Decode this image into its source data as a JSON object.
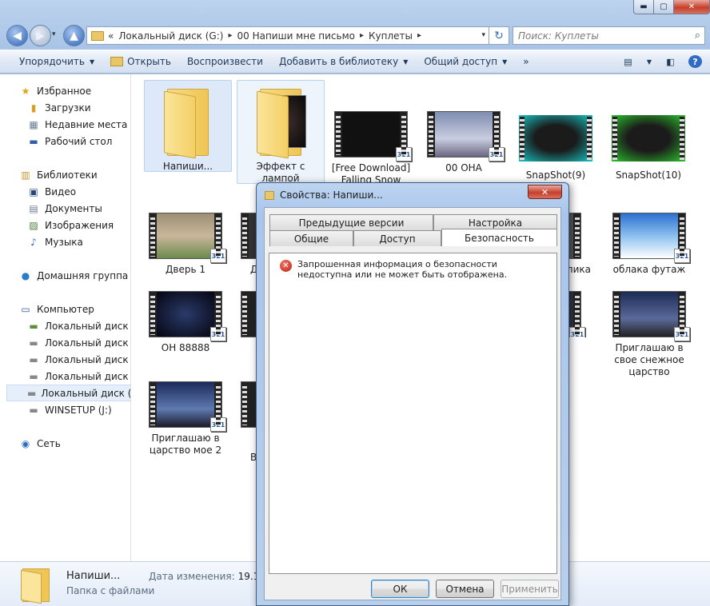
{
  "window": {
    "min": "▬",
    "max": "▢",
    "close": "✕"
  },
  "nav_buttons": {
    "back": "◀",
    "forward": "▶",
    "dropdown": "▾",
    "up": "▲"
  },
  "address": {
    "prefix": "«",
    "crumbs": [
      "Локальный диск (G:)",
      "00 Напиши мне письмо",
      "Куплеты"
    ],
    "sep": "▸",
    "dropdown": "▾",
    "refresh": "↻"
  },
  "search": {
    "placeholder": "Поиск: Куплеты",
    "icon": "⌕"
  },
  "toolbar": {
    "organize": "Упорядочить",
    "open": "Открыть",
    "play": "Воспроизвести",
    "add_library": "Добавить в библиотеку",
    "share": "Общий доступ",
    "more": "»",
    "dd": "▼",
    "view_icon": "▤",
    "preview_icon": "◧",
    "help_icon": "?"
  },
  "nav": {
    "favorites": "Избранное",
    "downloads": "Загрузки",
    "recent": "Недавние места",
    "desktop": "Рабочий стол",
    "libraries": "Библиотеки",
    "video": "Видео",
    "documents": "Документы",
    "images": "Изображения",
    "music": "Музыка",
    "homegroup": "Домашняя группа",
    "computer": "Компьютер",
    "disk_c": "Локальный диск (C:)",
    "disk_d": "Локальный диск (D:)",
    "disk_e": "Локальный диск (E:)",
    "disk_f": "Локальный диск (F:)",
    "disk_g": "Локальный диск (G:)",
    "winsetup": "WINSETUP (J:)",
    "network": "Сеть"
  },
  "files": {
    "f1": "Напиши...",
    "f2": "Эффект с лампой",
    "f3": "[Free Download] Falling Snow",
    "f4": "00 ОНА",
    "f5": "SnapShot(9)",
    "f6": "SnapShot(10)",
    "f7": "Дверь 1",
    "f8": "облака футаж",
    "f9": "ОН 88888",
    "f10": "Приглашаю в свое снежное царство",
    "f11": "Приглашаю в царство мое 2",
    "partial1": "Д",
    "partial2": "лика",
    "partial3": "В",
    "badge": "321"
  },
  "details": {
    "name": "Напиши...",
    "type": "Папка с файлами",
    "date_label": "Дата изменения:",
    "date_value": "19.10.20"
  },
  "dialog": {
    "title": "Свойства: Напиши...",
    "close": "✕",
    "tabs": {
      "prev_versions": "Предыдущие версии",
      "settings": "Настройка",
      "general": "Общие",
      "access": "Доступ",
      "security": "Безопасность"
    },
    "error_icon": "✕",
    "message": "Запрошенная информация о безопасности недоступна или не может быть отображена.",
    "ok": "ОК",
    "cancel": "Отмена",
    "apply": "Применить"
  }
}
